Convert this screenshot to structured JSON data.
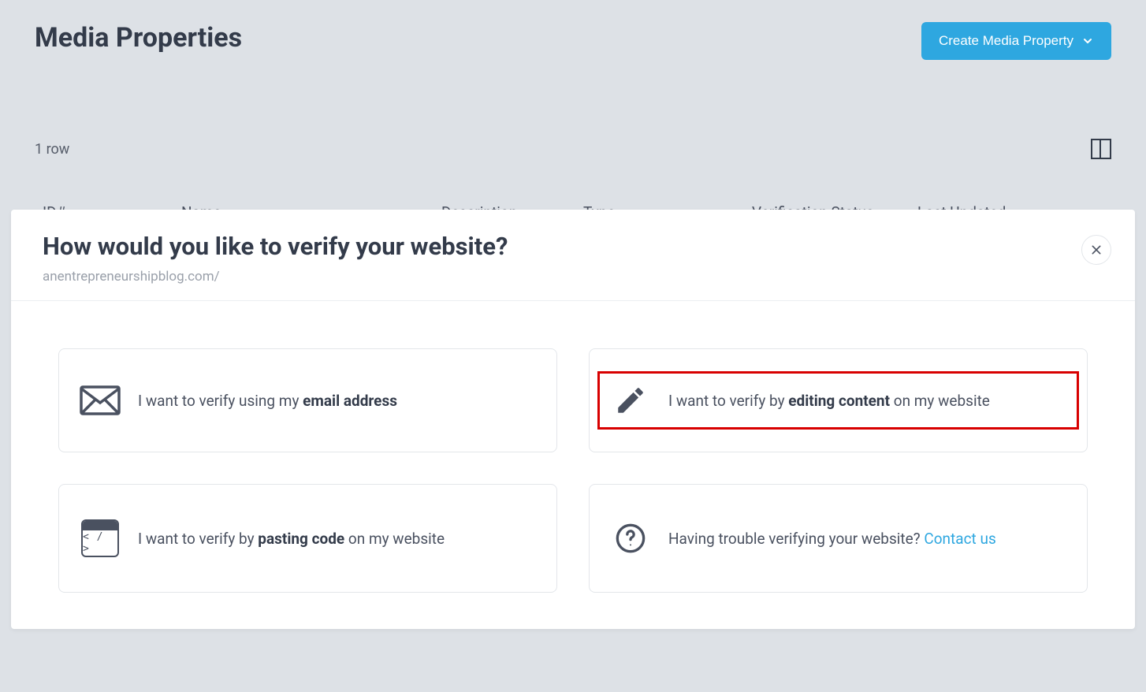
{
  "header": {
    "title": "Media Properties",
    "create_label": "Create Media Property"
  },
  "table": {
    "row_count_label": "1 row",
    "columns": {
      "id": "ID#",
      "name": "Name",
      "description": "Description",
      "type": "Type",
      "verification": "Verification Status",
      "updated": "Last Updated"
    }
  },
  "modal": {
    "title": "How would you like to verify your website?",
    "subtitle": "anentrepreneurshipblog.com/",
    "options": {
      "email": {
        "prefix": "I want to verify using my ",
        "bold": "email address",
        "suffix": ""
      },
      "edit": {
        "prefix": "I want to verify by ",
        "bold": "editing content",
        "suffix": " on my website"
      },
      "code": {
        "prefix": "I want to verify by ",
        "bold": "pasting code",
        "suffix": " on my website"
      },
      "help": {
        "text": "Having trouble verifying your website? ",
        "link": "Contact us"
      }
    }
  }
}
